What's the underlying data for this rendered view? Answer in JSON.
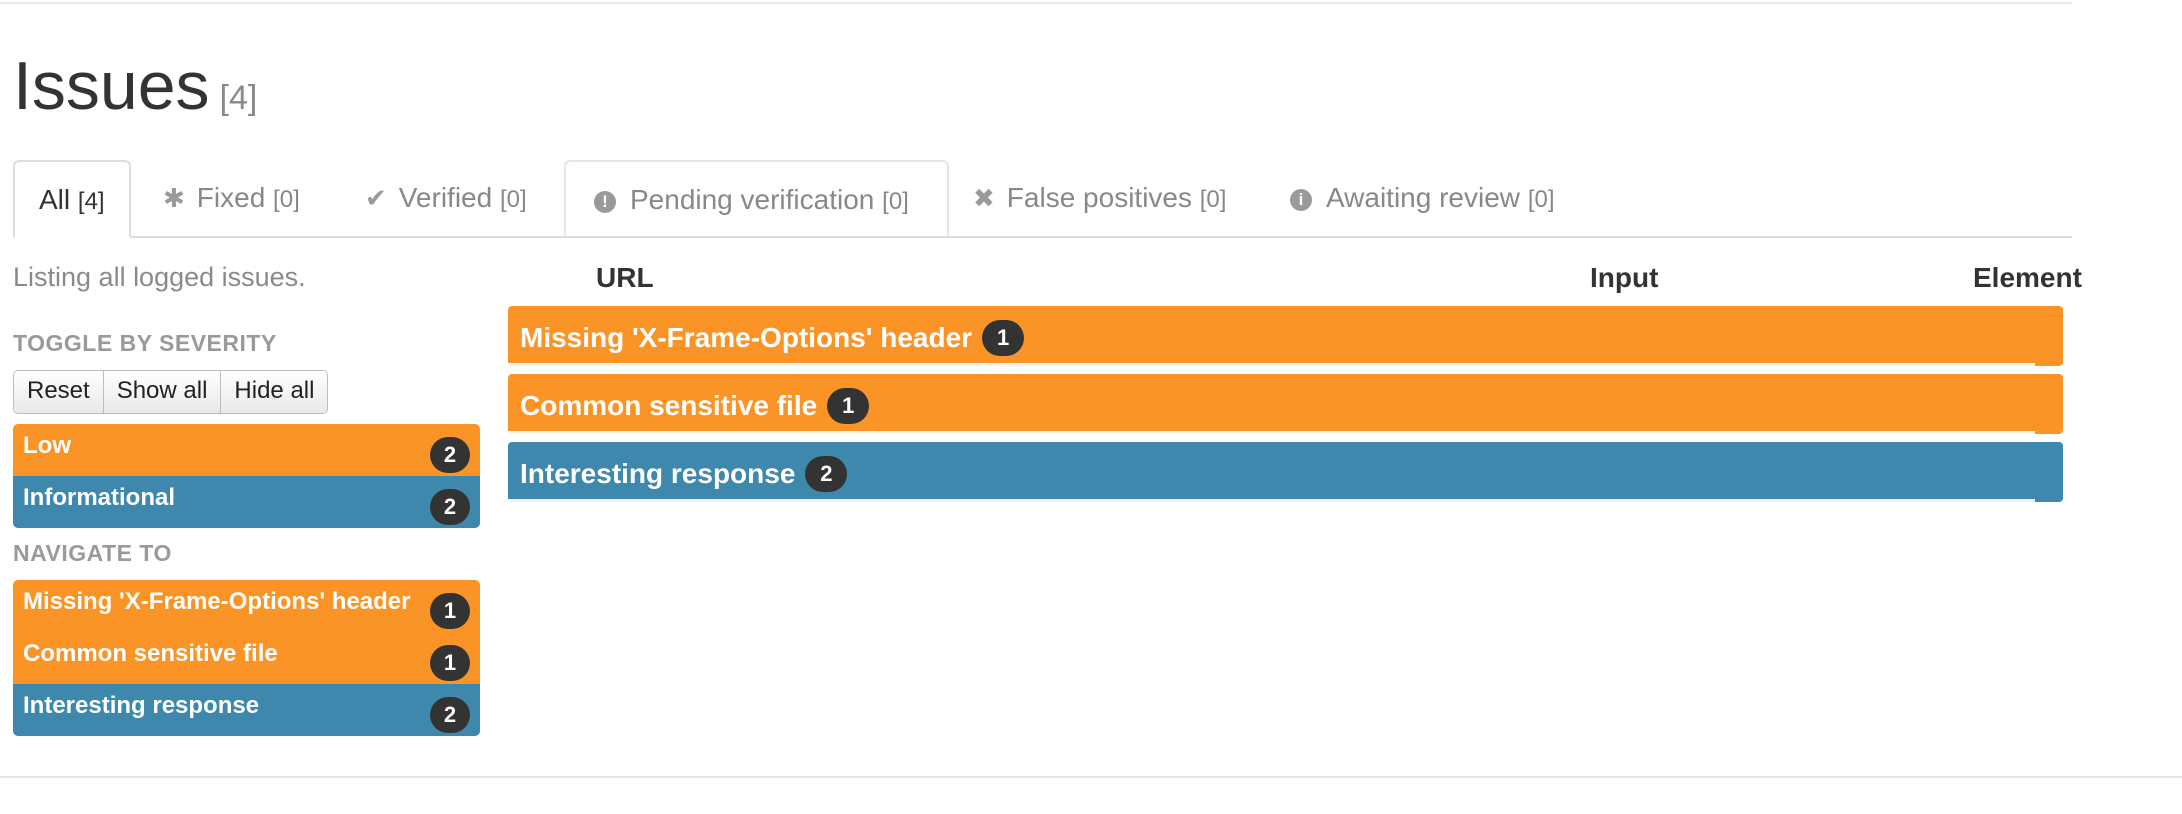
{
  "page": {
    "title": "Issues",
    "count": "[4]"
  },
  "tabs": [
    {
      "label": "All",
      "count": "[4]",
      "icon": ""
    },
    {
      "label": "Fixed",
      "count": "[0]",
      "icon": "asterisk-icon"
    },
    {
      "label": "Verified",
      "count": "[0]",
      "icon": "check-icon"
    },
    {
      "label": "Pending verification",
      "count": "[0]",
      "icon": "exclamation-circle-icon"
    },
    {
      "label": "False positives",
      "count": "[0]",
      "icon": "times-icon"
    },
    {
      "label": "Awaiting review",
      "count": "[0]",
      "icon": "info-circle-icon"
    }
  ],
  "sidebar": {
    "intro": "Listing all logged issues.",
    "toggle_title": "TOGGLE BY SEVERITY",
    "buttons": {
      "reset": "Reset",
      "show_all": "Show all",
      "hide_all": "Hide all"
    },
    "severities": [
      {
        "label": "Low",
        "count": "2",
        "color": "#fa9426"
      },
      {
        "label": "Informational",
        "count": "2",
        "color": "#3e87ad"
      }
    ],
    "navigate_title": "NAVIGATE TO",
    "navigate": [
      {
        "label": "Missing 'X-Frame-Options' header",
        "count": "1",
        "color": "#fa9426"
      },
      {
        "label": "Common sensitive file",
        "count": "1",
        "color": "#fa9426"
      },
      {
        "label": "Interesting response",
        "count": "2",
        "color": "#3e87ad"
      }
    ]
  },
  "table": {
    "columns": {
      "url": "URL",
      "input": "Input",
      "element": "Element"
    },
    "issues": [
      {
        "label": "Missing 'X-Frame-Options' header",
        "count": "1",
        "color": "#fa9426"
      },
      {
        "label": "Common sensitive file",
        "count": "1",
        "color": "#fa9426"
      },
      {
        "label": "Interesting response",
        "count": "2",
        "color": "#3e87ad"
      }
    ]
  }
}
